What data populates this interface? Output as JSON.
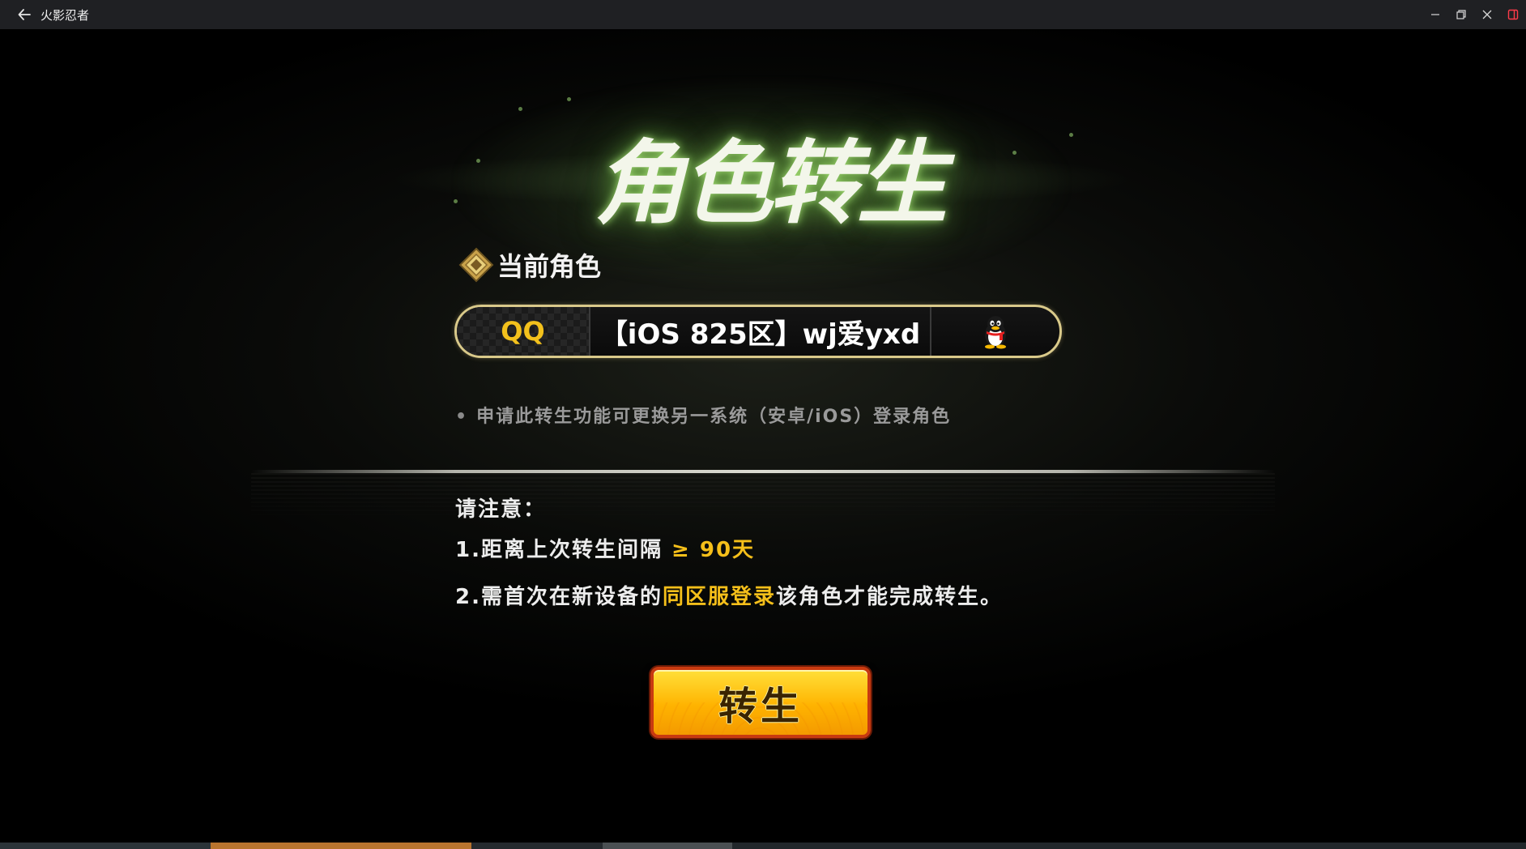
{
  "window": {
    "title": "火影忍者",
    "back_icon": "arrow-left-icon",
    "controls": [
      "minimize-icon",
      "restore-icon",
      "close-icon",
      "sidebar-toggle-icon"
    ]
  },
  "game": {
    "title": "角色转生",
    "current_role_label": "当前角色",
    "character": {
      "platform": "QQ",
      "name": "【iOS 825区】wj爱yxd",
      "platform_icon": "qq-penguin-icon"
    },
    "hint": "申请此转生功能可更换另一系统（安卓/iOS）登录角色",
    "notice": {
      "title": "请注意：",
      "line1_prefix": "1.距离上次转生间隔",
      "line1_highlight": "≥ 90天",
      "line2_prefix": "2.需首次在新设备的",
      "line2_highlight": "同区服登录",
      "line2_suffix": "该角色才能完成转生。"
    },
    "action_button": "转生"
  },
  "colors": {
    "highlight": "#f5bf1a",
    "qq_text": "#f3c11c",
    "button_gold": "#ffb300",
    "frame_gold": "#d9c98a"
  }
}
